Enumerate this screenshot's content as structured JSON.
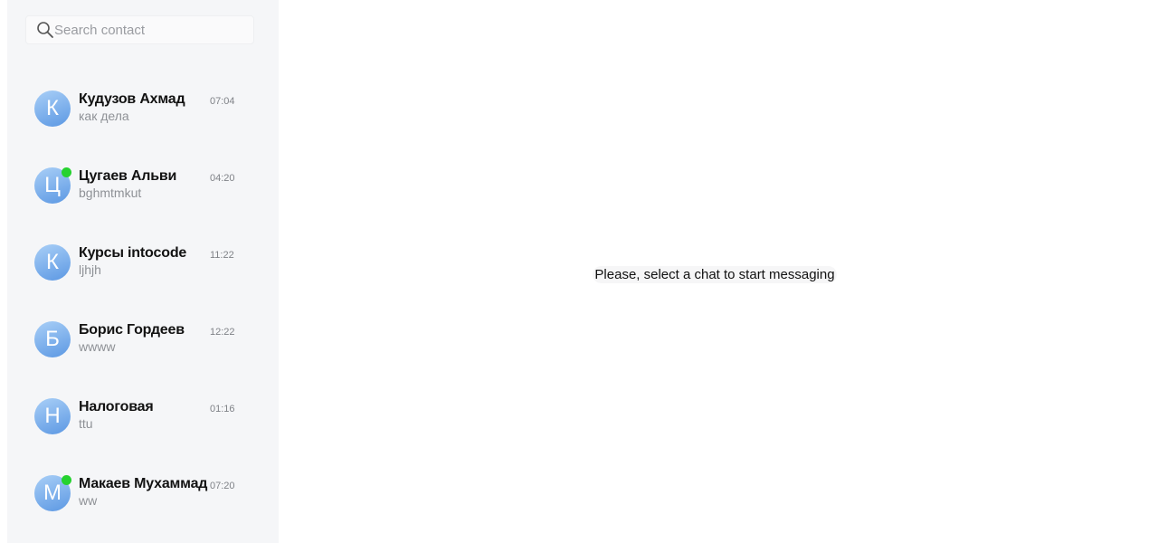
{
  "search": {
    "placeholder": "Search contact",
    "icon": "search-icon"
  },
  "contacts": [
    {
      "initial": "К",
      "name": "Кудузов Ахмад",
      "last_message": "как дела",
      "time": "07:04",
      "online": false
    },
    {
      "initial": "Ц",
      "name": "Цугаев Альви",
      "last_message": "bghmtmkut",
      "time": "04:20",
      "online": true
    },
    {
      "initial": "К",
      "name": "Курсы intocode",
      "last_message": "ljhjh",
      "time": "11:22",
      "online": false
    },
    {
      "initial": "Б",
      "name": "Борис Гордеев",
      "last_message": "wwww",
      "time": "12:22",
      "online": false
    },
    {
      "initial": "Н",
      "name": "Налоговая",
      "last_message": "ttu",
      "time": "01:16",
      "online": false
    },
    {
      "initial": "М",
      "name": "Макаев Мухаммад",
      "last_message": "ww",
      "time": "07:20",
      "online": true
    }
  ],
  "main": {
    "empty_message": "Please, select a chat to start messaging"
  },
  "colors": {
    "sidebar_bg": "#f5f6f8",
    "avatar_gradient_start": "#a9cff7",
    "avatar_gradient_end": "#5c98e3",
    "online_indicator": "#26d22f"
  }
}
